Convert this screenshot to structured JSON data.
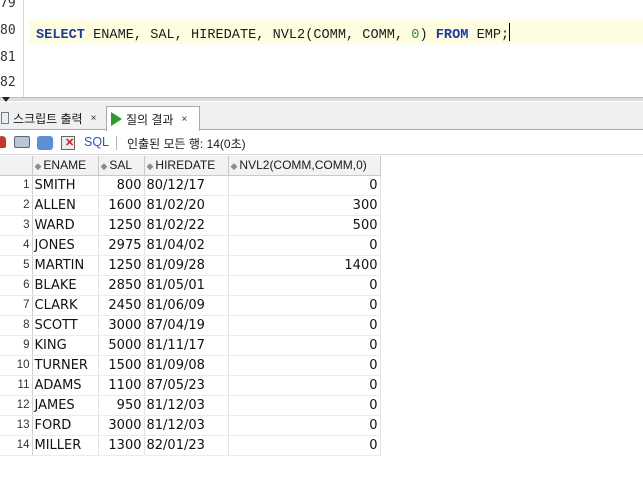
{
  "editor": {
    "line_numbers": [
      "79",
      "80",
      "81",
      "82"
    ],
    "sql": {
      "kw_select": "SELECT",
      "columns": " ENAME, SAL, HIREDATE, NVL2(COMM, COMM, ",
      "zero": "0",
      "close": ") ",
      "kw_from": "FROM",
      "table": " EMP;"
    }
  },
  "tabs": [
    {
      "label": "스크립트 출력",
      "close": "×"
    },
    {
      "label": "질의 결과",
      "close": "×"
    }
  ],
  "toolbar": {
    "sql_label": "SQL",
    "status": "인출된 모든 행: 14(0초)"
  },
  "grid": {
    "headers": [
      "ENAME",
      "SAL",
      "HIREDATE",
      "NVL2(COMM,COMM,0)"
    ],
    "rows": [
      {
        "n": "1",
        "ename": "SMITH",
        "sal": "800",
        "hiredate": "80/12/17",
        "nvl": "0"
      },
      {
        "n": "2",
        "ename": "ALLEN",
        "sal": "1600",
        "hiredate": "81/02/20",
        "nvl": "300"
      },
      {
        "n": "3",
        "ename": "WARD",
        "sal": "1250",
        "hiredate": "81/02/22",
        "nvl": "500"
      },
      {
        "n": "4",
        "ename": "JONES",
        "sal": "2975",
        "hiredate": "81/04/02",
        "nvl": "0"
      },
      {
        "n": "5",
        "ename": "MARTIN",
        "sal": "1250",
        "hiredate": "81/09/28",
        "nvl": "1400"
      },
      {
        "n": "6",
        "ename": "BLAKE",
        "sal": "2850",
        "hiredate": "81/05/01",
        "nvl": "0"
      },
      {
        "n": "7",
        "ename": "CLARK",
        "sal": "2450",
        "hiredate": "81/06/09",
        "nvl": "0"
      },
      {
        "n": "8",
        "ename": "SCOTT",
        "sal": "3000",
        "hiredate": "87/04/19",
        "nvl": "0"
      },
      {
        "n": "9",
        "ename": "KING",
        "sal": "5000",
        "hiredate": "81/11/17",
        "nvl": "0"
      },
      {
        "n": "10",
        "ename": "TURNER",
        "sal": "1500",
        "hiredate": "81/09/08",
        "nvl": "0"
      },
      {
        "n": "11",
        "ename": "ADAMS",
        "sal": "1100",
        "hiredate": "87/05/23",
        "nvl": "0"
      },
      {
        "n": "12",
        "ename": "JAMES",
        "sal": "950",
        "hiredate": "81/12/03",
        "nvl": "0"
      },
      {
        "n": "13",
        "ename": "FORD",
        "sal": "3000",
        "hiredate": "81/12/03",
        "nvl": "0"
      },
      {
        "n": "14",
        "ename": "MILLER",
        "sal": "1300",
        "hiredate": "82/01/23",
        "nvl": "0"
      }
    ]
  }
}
